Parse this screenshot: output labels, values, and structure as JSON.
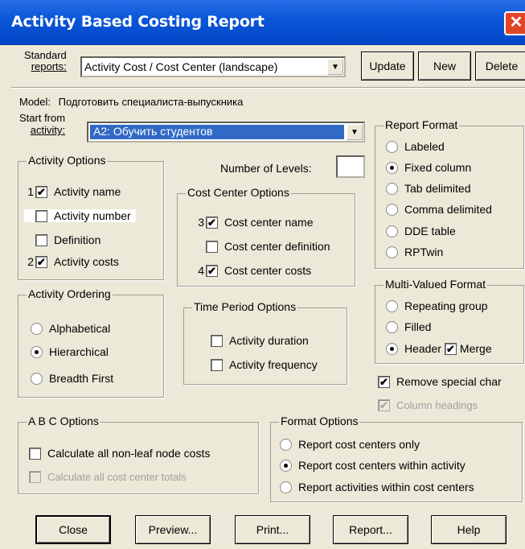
{
  "window": {
    "title": "Activity Based Costing Report",
    "close_icon": "close-icon"
  },
  "standard": {
    "label_line1": "Standard",
    "label_line2": "reports:",
    "value": "Activity Cost / Cost Center (landscape)",
    "update": "Update",
    "new": "New",
    "delete": "Delete"
  },
  "model": {
    "label": "Model:",
    "value": "Подготовить специалиста-выпускника"
  },
  "start": {
    "label_line1": "Start from",
    "label_line2": "activity:",
    "value": "A2: Обучить  студентов"
  },
  "levels": {
    "label": "Number of Levels:",
    "value": ""
  },
  "activity_options": {
    "title": "Activity Options",
    "items": [
      {
        "num": "1",
        "label": "Activity name",
        "checked": true
      },
      {
        "num": "",
        "label": "Activity number",
        "checked": false
      },
      {
        "num": "",
        "label": "Definition",
        "checked": false
      },
      {
        "num": "2",
        "label": "Activity costs",
        "checked": true
      }
    ]
  },
  "cost_center_options": {
    "title": "Cost Center Options",
    "items": [
      {
        "num": "3",
        "label": "Cost center name",
        "checked": true
      },
      {
        "num": "",
        "label": "Cost center definition",
        "checked": false
      },
      {
        "num": "4",
        "label": "Cost center costs",
        "checked": true
      }
    ]
  },
  "activity_ordering": {
    "title": "Activity Ordering",
    "items": [
      {
        "label": "Alphabetical",
        "selected": false
      },
      {
        "label": "Hierarchical",
        "selected": true
      },
      {
        "label": "Breadth First",
        "selected": false
      }
    ]
  },
  "time_period": {
    "title": "Time Period Options",
    "items": [
      {
        "label": "Activity duration",
        "checked": false
      },
      {
        "label": "Activity frequency",
        "checked": false
      }
    ]
  },
  "report_format": {
    "title": "Report Format",
    "items": [
      {
        "label": "Labeled",
        "selected": false
      },
      {
        "label": "Fixed column",
        "selected": true
      },
      {
        "label": "Tab delimited",
        "selected": false
      },
      {
        "label": "Comma delimited",
        "selected": false
      },
      {
        "label": "DDE table",
        "selected": false
      },
      {
        "label": "RPTwin",
        "selected": false
      }
    ]
  },
  "multi_valued": {
    "title": "Multi-Valued Format",
    "items": [
      {
        "label": "Repeating group",
        "selected": false
      },
      {
        "label": "Filled",
        "selected": false
      },
      {
        "label": "Header",
        "selected": true
      }
    ],
    "merge_label": "Merge",
    "merge_checked": true
  },
  "remove_special": {
    "label": "Remove special char",
    "checked": true
  },
  "column_headings": {
    "label": "Column headings",
    "checked": true
  },
  "abc_options": {
    "title": "A B C  Options",
    "items": [
      {
        "label": "Calculate all non-leaf node costs",
        "checked": false
      },
      {
        "label": "Calculate all cost center totals",
        "checked": false
      }
    ]
  },
  "format_options": {
    "title": "Format Options",
    "items": [
      {
        "label": "Report cost centers only",
        "selected": false
      },
      {
        "label": "Report cost centers within activity",
        "selected": true
      },
      {
        "label": "Report activities within cost centers",
        "selected": false
      }
    ]
  },
  "buttons": {
    "close": "Close",
    "preview": "Preview...",
    "print": "Print...",
    "report": "Report...",
    "help": "Help"
  },
  "check_glyph": "✔",
  "arrow_glyph": "▼"
}
